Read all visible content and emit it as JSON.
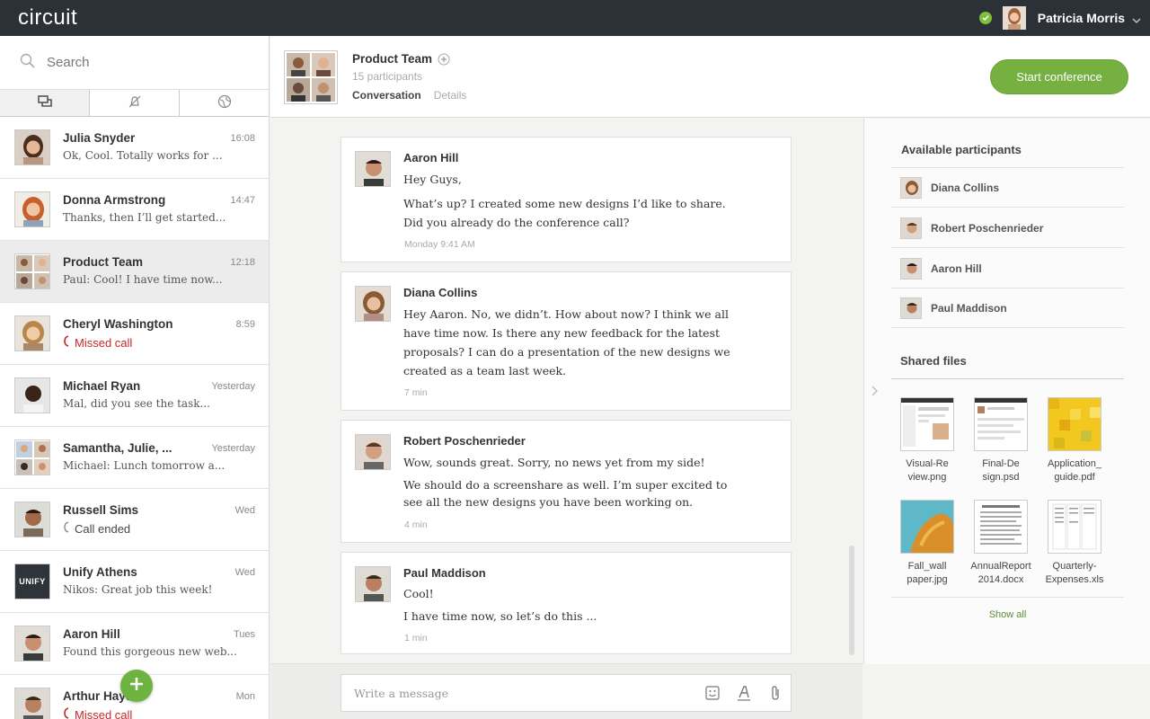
{
  "app": {
    "logo": "circuit"
  },
  "user": {
    "name": "Patricia Morris",
    "status_color": "#7bbf3a"
  },
  "search": {
    "placeholder": "Search"
  },
  "sidebar_tabs": [
    {
      "icon": "conversations-icon",
      "active": true
    },
    {
      "icon": "muted-icon",
      "active": false
    },
    {
      "icon": "globe-icon",
      "active": false
    }
  ],
  "conversations": [
    {
      "name": "Julia Snyder",
      "time": "16:08",
      "preview": "Ok, Cool. Totally works for ...",
      "type": "text"
    },
    {
      "name": "Donna Armstrong",
      "time": "14:47",
      "preview": "Thanks, then I’ll get started...",
      "type": "text"
    },
    {
      "name": "Product Team",
      "time": "12:18",
      "preview": "Paul: Cool! I have time now...",
      "type": "text",
      "selected": true
    },
    {
      "name": "Cheryl Washington",
      "time": "8:59",
      "preview": "Missed call",
      "type": "missed"
    },
    {
      "name": "Michael Ryan",
      "time": "Yesterday",
      "preview": "Mal, did you see the task...",
      "type": "text"
    },
    {
      "name": "Samantha, Julie, ...",
      "time": "Yesterday",
      "preview": "Michael: Lunch tomorrow a...",
      "type": "text"
    },
    {
      "name": "Russell Sims",
      "time": "Wed",
      "preview": "Call ended",
      "type": "ended"
    },
    {
      "name": "Unify Athens",
      "time": "Wed",
      "preview": "Nikos: Great job this week!",
      "type": "text",
      "logo_text": "UNIFY"
    },
    {
      "name": "Aaron Hill",
      "time": "Tues",
      "preview": "Found this gorgeous new web...",
      "type": "text"
    },
    {
      "name": "Arthur Hayes",
      "time": "Mon",
      "preview": "Missed call",
      "type": "missed"
    }
  ],
  "header": {
    "title": "Product Team",
    "participants": "15 participants",
    "tab_conversation": "Conversation",
    "tab_details": "Details",
    "conference_button": "Start conference"
  },
  "messages": [
    {
      "sender": "Aaron Hill",
      "lines": [
        "Hey Guys,",
        "What’s up? I created some new designs I’d like to share.",
        "Did you already do the conference call?"
      ],
      "time": "Monday 9:41 AM"
    },
    {
      "sender": "Diana Collins",
      "lines": [
        "Hey Aaron. No, we didn’t. How about now? I think we all",
        "have time now. Is there any new feedback for the latest",
        "proposals? I can do a presentation of the new designs we",
        "created as a team last week."
      ],
      "time": "7 min"
    },
    {
      "sender": "Robert Poschenrieder",
      "lines": [
        "Wow, sounds great. Sorry, no news yet from my side!",
        "We should do a screenshare as well. I’m super excited to",
        "see all the new designs you have been working on."
      ],
      "time": "4 min"
    },
    {
      "sender": "Paul Maddison",
      "lines": [
        "Cool!",
        "I have time now, so let’s do this ..."
      ],
      "time": "1 min"
    }
  ],
  "compose": {
    "placeholder": "Write a message"
  },
  "right_panel": {
    "participants_title": "Available participants",
    "participants": [
      "Diana Collins",
      "Robert Poschenrieder",
      "Aaron Hill",
      "Paul Maddison"
    ],
    "files_title": "Shared files",
    "files": [
      {
        "line1": "Visual-Re",
        "line2": "view.png"
      },
      {
        "line1": "Final-De",
        "line2": "sign.psd"
      },
      {
        "line1": "Application_",
        "line2": "guide.pdf"
      },
      {
        "line1": "Fall_wall",
        "line2": "paper.jpg"
      },
      {
        "line1": "AnnualReport",
        "line2": "2014.docx"
      },
      {
        "line1": "Quarterly-",
        "line2": "Expenses.xls"
      }
    ],
    "show_all": "Show all"
  },
  "colors": {
    "accent": "#76b041",
    "topbar": "#2c3138",
    "missed": "#c62828"
  }
}
